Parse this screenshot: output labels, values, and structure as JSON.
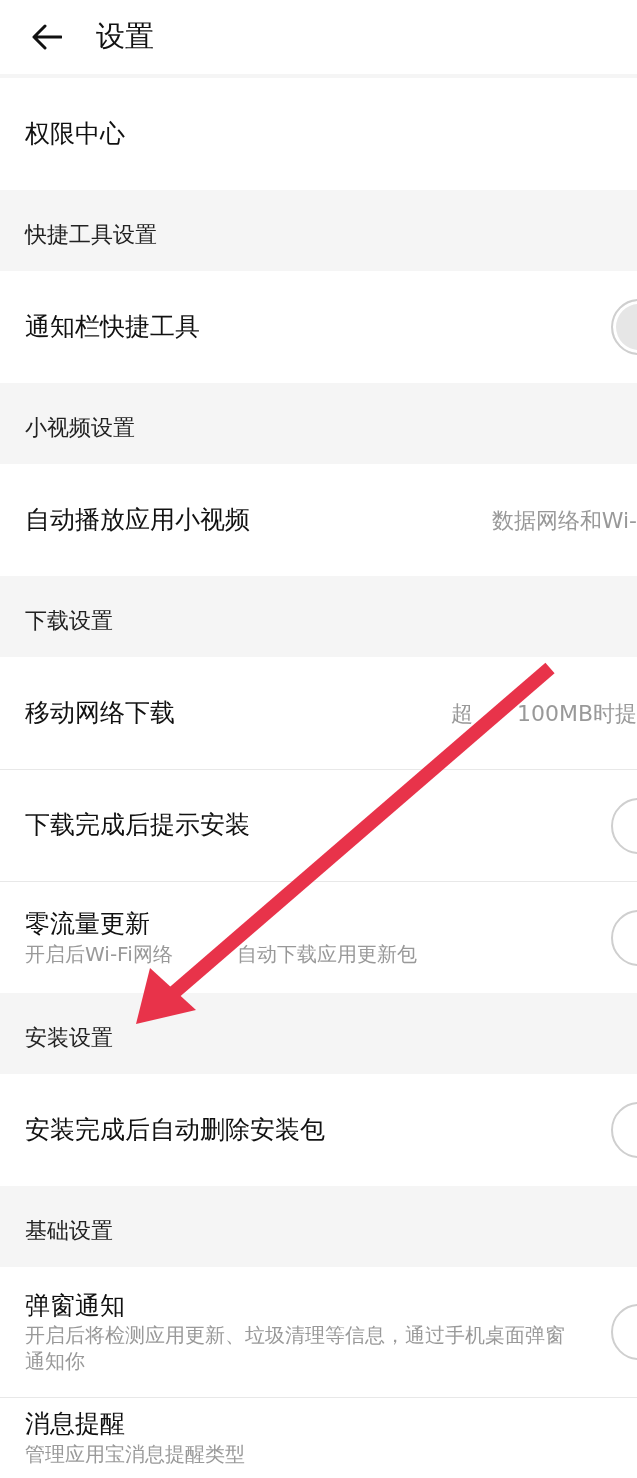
{
  "header": {
    "title": "设置"
  },
  "groups": [
    {
      "rows": [
        {
          "kind": "link",
          "label": "权限中心"
        }
      ]
    },
    {
      "heading": "快捷工具设置",
      "rows": [
        {
          "kind": "toggle",
          "label": "通知栏快捷工具",
          "on": false,
          "disabled": true
        }
      ]
    },
    {
      "heading": "小视频设置",
      "rows": [
        {
          "kind": "value",
          "label": "自动播放应用小视频",
          "value": [
            "数据网络和Wi-"
          ]
        }
      ]
    },
    {
      "heading": "下载设置",
      "rows": [
        {
          "kind": "value",
          "label": "移动网络下载",
          "value": [
            "超",
            "100MB时提"
          ]
        },
        {
          "kind": "toggle",
          "label": "下载完成后提示安装",
          "on": false,
          "disabled": false
        },
        {
          "kind": "toggle",
          "label": "零流量更新",
          "subtitle": [
            "开启后Wi-Fi网络",
            "自动下载应用更新包"
          ],
          "on": false,
          "disabled": false
        }
      ]
    },
    {
      "heading": "安装设置",
      "rows": [
        {
          "kind": "toggle",
          "label": "安装完成后自动删除安装包",
          "on": false,
          "disabled": false
        }
      ]
    },
    {
      "heading": "基础设置",
      "rows": [
        {
          "kind": "toggle",
          "label": "弹窗通知",
          "subtitle": [
            "开启后将检测应用更新、垃圾清理等信息，通过手机桌面弹窗通知你"
          ],
          "on": false,
          "disabled": false
        },
        {
          "kind": "link",
          "label": "消息提醒",
          "subtitle": [
            "管理应用宝消息提醒类型"
          ]
        }
      ]
    }
  ]
}
